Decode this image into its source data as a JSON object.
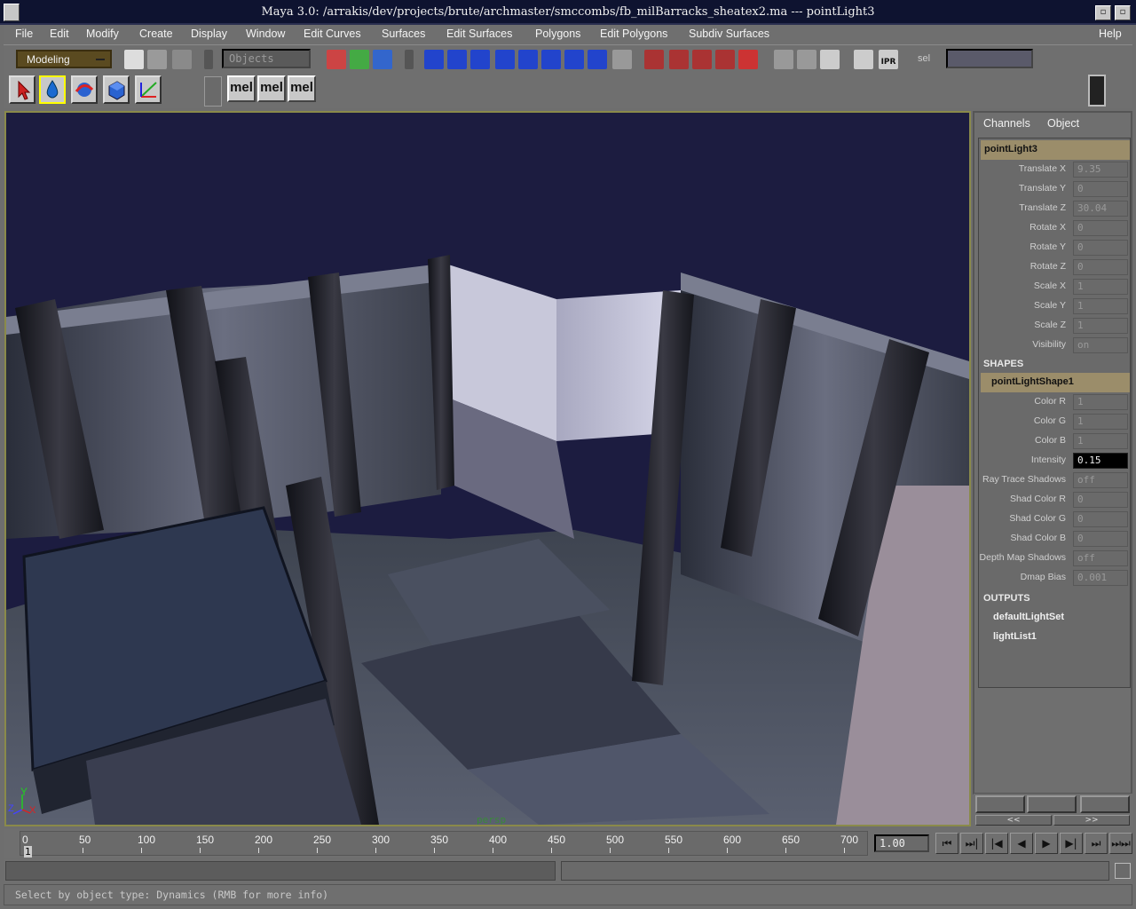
{
  "window": {
    "title": "Maya 3.0: /arrakis/dev/projects/brute/archmaster/smccombs/fb_milBarracks_sheatex2.ma  ---  pointLight3",
    "minimize_glyph": "▫",
    "maximize_glyph": "▫"
  },
  "menubar": {
    "items": [
      "File",
      "Edit",
      "Modify",
      "Create",
      "Display",
      "Window",
      "Edit Curves",
      "Surfaces",
      "Edit Surfaces",
      "Polygons",
      "Edit Polygons",
      "Subdiv Surfaces"
    ],
    "help": "Help"
  },
  "statusline": {
    "mode": "Modeling",
    "select_field_placeholder": "Objects",
    "sel_label": "sel",
    "ipr_label": "IPR"
  },
  "shelf": {
    "mel_buttons": [
      "mel",
      "mel",
      "mel"
    ]
  },
  "viewport": {
    "camera_label": "persp",
    "axis_y": "Y",
    "axis_z": "Z",
    "axis_x": "X"
  },
  "channelbox": {
    "tabs": [
      "Channels",
      "Object"
    ],
    "node": "pointLight3",
    "transform_attrs": [
      {
        "label": "Translate X",
        "value": "9.35"
      },
      {
        "label": "Translate Y",
        "value": "0"
      },
      {
        "label": "Translate Z",
        "value": "30.04"
      },
      {
        "label": "Rotate X",
        "value": "0"
      },
      {
        "label": "Rotate Y",
        "value": "0"
      },
      {
        "label": "Rotate Z",
        "value": "0"
      },
      {
        "label": "Scale X",
        "value": "1"
      },
      {
        "label": "Scale Y",
        "value": "1"
      },
      {
        "label": "Scale Z",
        "value": "1"
      },
      {
        "label": "Visibility",
        "value": "on"
      }
    ],
    "shapes_header": "SHAPES",
    "shape_node": "pointLightShape1",
    "shape_attrs": [
      {
        "label": "Color R",
        "value": "1"
      },
      {
        "label": "Color G",
        "value": "1"
      },
      {
        "label": "Color B",
        "value": "1"
      },
      {
        "label": "Intensity",
        "value": "0.15"
      },
      {
        "label": "Ray Trace Shadows",
        "value": "off"
      },
      {
        "label": "Shad Color R",
        "value": "0"
      },
      {
        "label": "Shad Color G",
        "value": "0"
      },
      {
        "label": "Shad Color B",
        "value": "0"
      },
      {
        "label": "Depth Map Shadows",
        "value": "off"
      },
      {
        "label": "Dmap Bias",
        "value": "0.001"
      }
    ],
    "outputs_header": "OUTPUTS",
    "outputs": [
      "defaultLightSet",
      "lightList1"
    ],
    "layer_left": "<<",
    "layer_right": ">>"
  },
  "timeslider": {
    "ticks": [
      "0",
      "50",
      "100",
      "150",
      "200",
      "250",
      "300",
      "350",
      "400",
      "450",
      "500",
      "550",
      "600",
      "650",
      "700"
    ],
    "current_frame": "1",
    "current_time": "1.00"
  },
  "playback": [
    "⏮",
    "⏭|",
    "|◀",
    "◀",
    "▶",
    "▶|",
    "⏭",
    "⏭⏭"
  ],
  "helpline": {
    "text": "Select by object type: Dynamics (RMB for more info)"
  },
  "colors": {
    "title_bg": "#0e1330",
    "viewport_bg": "#1a1a3c",
    "channel_header": "#9b8d6a",
    "panel_bg": "#6f6f6f"
  }
}
